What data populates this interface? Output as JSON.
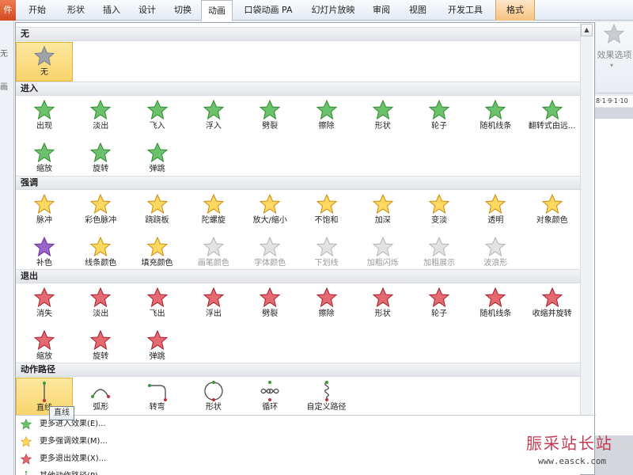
{
  "ribbon": {
    "tabs": [
      {
        "label": "件",
        "kind": "file"
      },
      {
        "label": "开始"
      },
      {
        "label": "形状"
      },
      {
        "label": "插入"
      },
      {
        "label": "设计"
      },
      {
        "label": "切换"
      },
      {
        "label": "动画",
        "kind": "active"
      },
      {
        "label": "口袋动画 PA"
      },
      {
        "label": "幻灯片放映"
      },
      {
        "label": "审阅"
      },
      {
        "label": "视图"
      },
      {
        "label": "开发工具"
      },
      {
        "label": "格式",
        "kind": "ctx"
      }
    ],
    "left_labels": [
      "无",
      "画"
    ],
    "effect_options": {
      "label": "效果选项",
      "icon": "star-icon"
    },
    "ruler_text": "8·1·9·1·10"
  },
  "gallery": {
    "sections": [
      {
        "title": "无",
        "items": [
          {
            "label": "无",
            "icon": "star-none",
            "selected": true
          }
        ]
      },
      {
        "title": "进入",
        "items": [
          {
            "label": "出现",
            "icon": "star-green"
          },
          {
            "label": "淡出",
            "icon": "star-green"
          },
          {
            "label": "飞入",
            "icon": "star-green"
          },
          {
            "label": "浮入",
            "icon": "star-green"
          },
          {
            "label": "劈裂",
            "icon": "star-green"
          },
          {
            "label": "擦除",
            "icon": "star-green"
          },
          {
            "label": "形状",
            "icon": "star-green"
          },
          {
            "label": "轮子",
            "icon": "star-green"
          },
          {
            "label": "随机线条",
            "icon": "star-green"
          },
          {
            "label": "翻转式由远...",
            "icon": "star-green"
          },
          {
            "label": "缩放",
            "icon": "star-green"
          },
          {
            "label": "旋转",
            "icon": "star-green"
          },
          {
            "label": "弹跳",
            "icon": "star-green"
          }
        ]
      },
      {
        "title": "强调",
        "items": [
          {
            "label": "脉冲",
            "icon": "star-gold"
          },
          {
            "label": "彩色脉冲",
            "icon": "star-gold"
          },
          {
            "label": "跷跷板",
            "icon": "star-gold"
          },
          {
            "label": "陀螺旋",
            "icon": "star-gold"
          },
          {
            "label": "放大/缩小",
            "icon": "star-gold"
          },
          {
            "label": "不饱和",
            "icon": "star-gold"
          },
          {
            "label": "加深",
            "icon": "star-gold"
          },
          {
            "label": "变淡",
            "icon": "star-gold"
          },
          {
            "label": "透明",
            "icon": "star-gold"
          },
          {
            "label": "对象颜色",
            "icon": "star-gold"
          },
          {
            "label": "补色",
            "icon": "star-purple"
          },
          {
            "label": "线条颜色",
            "icon": "star-gold"
          },
          {
            "label": "填充颜色",
            "icon": "star-gold"
          },
          {
            "label": "画笔颜色",
            "icon": "star-gray",
            "dim": true
          },
          {
            "label": "字体颜色",
            "icon": "star-gray",
            "dim": true
          },
          {
            "label": "下划线",
            "icon": "star-gray",
            "dim": true
          },
          {
            "label": "加粗闪烁",
            "icon": "star-gray",
            "dim": true
          },
          {
            "label": "加粗展示",
            "icon": "star-gray",
            "dim": true
          },
          {
            "label": "波浪形",
            "icon": "star-gray",
            "dim": true
          }
        ]
      },
      {
        "title": "退出",
        "items": [
          {
            "label": "消失",
            "icon": "star-red"
          },
          {
            "label": "淡出",
            "icon": "star-red"
          },
          {
            "label": "飞出",
            "icon": "star-red"
          },
          {
            "label": "浮出",
            "icon": "star-red"
          },
          {
            "label": "劈裂",
            "icon": "star-red"
          },
          {
            "label": "擦除",
            "icon": "star-red"
          },
          {
            "label": "形状",
            "icon": "star-red"
          },
          {
            "label": "轮子",
            "icon": "star-red"
          },
          {
            "label": "随机线条",
            "icon": "star-red"
          },
          {
            "label": "收缩并旋转",
            "icon": "star-red"
          },
          {
            "label": "缩放",
            "icon": "star-red"
          },
          {
            "label": "旋转",
            "icon": "star-red"
          },
          {
            "label": "弹跳",
            "icon": "star-red"
          }
        ]
      },
      {
        "title": "动作路径",
        "items": [
          {
            "label": "直线",
            "icon": "path-line",
            "selected": true
          },
          {
            "label": "弧形",
            "icon": "path-arc"
          },
          {
            "label": "转弯",
            "icon": "path-turn"
          },
          {
            "label": "形状",
            "icon": "path-circle"
          },
          {
            "label": "循环",
            "icon": "path-loop"
          },
          {
            "label": "自定义路径",
            "icon": "path-custom"
          }
        ]
      }
    ],
    "tooltip": "直线",
    "more": [
      {
        "label": "更多进入效果(E)...",
        "icon": "star-green"
      },
      {
        "label": "更多强调效果(M)...",
        "icon": "star-gold"
      },
      {
        "label": "更多退出效果(X)...",
        "icon": "star-red"
      },
      {
        "label": "其他动作路径(P)...",
        "icon": "path-line"
      }
    ]
  },
  "colors": {
    "enter": "#3a9a3a",
    "emphasis": "#e0a820",
    "exit": "#c0303a",
    "disabled": "#c4c4c4",
    "selected_bg": "#f9d46b"
  },
  "watermark": {
    "title": "脤采站长站",
    "url": "www.easck.com"
  }
}
